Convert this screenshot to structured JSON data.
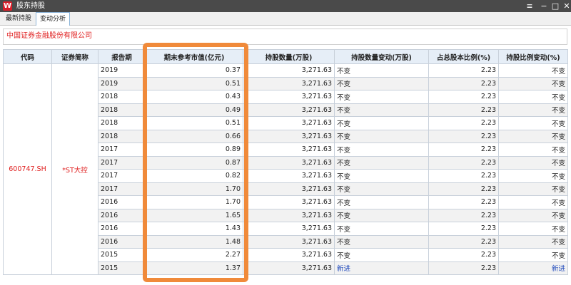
{
  "window": {
    "logo_text": "W",
    "title": "股东持股",
    "controls": {
      "menu": "≡",
      "minimize": "−",
      "maximize": "□",
      "close": "✕"
    }
  },
  "tabs": [
    {
      "label": "最新持股",
      "active": false
    },
    {
      "label": "变动分析",
      "active": true
    }
  ],
  "company": {
    "name": "中国证券金融股份有限公司"
  },
  "table": {
    "headers": [
      "代码",
      "证券简称",
      "报告期",
      "期末参考市值(亿元)",
      "持股数量(万股)",
      "持股数量变动(万股)",
      "占总股本比例(%)",
      "持股比例变动(%)"
    ],
    "code": "600747.SH",
    "stock_name": "*ST大控",
    "rows": [
      {
        "period": "2019",
        "value": "0.37",
        "shares": "3,271.63",
        "share_change": "不变",
        "ratio": "2.23",
        "ratio_change": "不变"
      },
      {
        "period": "2019",
        "value": "0.51",
        "shares": "3,271.63",
        "share_change": "不变",
        "ratio": "2.23",
        "ratio_change": "不变"
      },
      {
        "period": "2018",
        "value": "0.43",
        "shares": "3,271.63",
        "share_change": "不变",
        "ratio": "2.23",
        "ratio_change": "不变"
      },
      {
        "period": "2018",
        "value": "0.49",
        "shares": "3,271.63",
        "share_change": "不变",
        "ratio": "2.23",
        "ratio_change": "不变"
      },
      {
        "period": "2018",
        "value": "0.51",
        "shares": "3,271.63",
        "share_change": "不变",
        "ratio": "2.23",
        "ratio_change": "不变"
      },
      {
        "period": "2018",
        "value": "0.66",
        "shares": "3,271.63",
        "share_change": "不变",
        "ratio": "2.23",
        "ratio_change": "不变"
      },
      {
        "period": "2017",
        "value": "0.89",
        "shares": "3,271.63",
        "share_change": "不变",
        "ratio": "2.23",
        "ratio_change": "不变"
      },
      {
        "period": "2017",
        "value": "0.87",
        "shares": "3,271.63",
        "share_change": "不变",
        "ratio": "2.23",
        "ratio_change": "不变"
      },
      {
        "period": "2017",
        "value": "0.82",
        "shares": "3,271.63",
        "share_change": "不变",
        "ratio": "2.23",
        "ratio_change": "不变"
      },
      {
        "period": "2017",
        "value": "1.70",
        "shares": "3,271.63",
        "share_change": "不变",
        "ratio": "2.23",
        "ratio_change": "不变"
      },
      {
        "period": "2016",
        "value": "1.70",
        "shares": "3,271.63",
        "share_change": "不变",
        "ratio": "2.23",
        "ratio_change": "不变"
      },
      {
        "period": "2016",
        "value": "1.65",
        "shares": "3,271.63",
        "share_change": "不变",
        "ratio": "2.23",
        "ratio_change": "不变"
      },
      {
        "period": "2016",
        "value": "1.43",
        "shares": "3,271.63",
        "share_change": "不变",
        "ratio": "2.23",
        "ratio_change": "不变"
      },
      {
        "period": "2016",
        "value": "1.48",
        "shares": "3,271.63",
        "share_change": "不变",
        "ratio": "2.23",
        "ratio_change": "不变"
      },
      {
        "period": "2015",
        "value": "2.27",
        "shares": "3,271.63",
        "share_change": "不变",
        "ratio": "2.23",
        "ratio_change": "不变"
      },
      {
        "period": "2015",
        "value": "1.37",
        "shares": "3,271.63",
        "share_change": "新进",
        "ratio": "2.23",
        "ratio_change": "新进"
      }
    ]
  },
  "colors": {
    "accent_red": "#e02020",
    "highlight_orange": "#f08a3a",
    "new_entry_blue": "#2a52be",
    "header_bg": "#e6eef7"
  }
}
